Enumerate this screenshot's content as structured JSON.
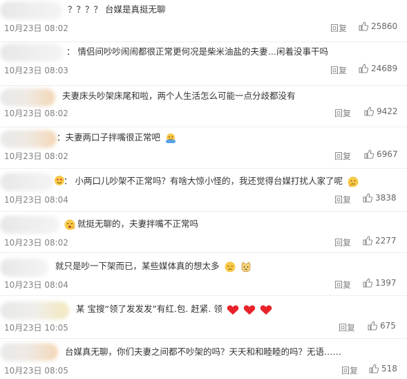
{
  "reply_label": "回复",
  "icons": {
    "like": "thumbs-up-icon",
    "heart": "heart-icon"
  },
  "comments": [
    {
      "text": "？？？？ 台媒是真挺无聊",
      "time": "10月23日 08:02",
      "likes": "25860"
    },
    {
      "text": "： 情侣间吵吵闹闹都很正常更何况是柴米油盐的夫妻…闲着没事干吗",
      "time": "10月23日 08:03",
      "likes": "24689"
    },
    {
      "text": "夫妻床头吵架床尾和啦，两个人生活怎么可能一点分歧都没有",
      "time": "10月23日 08:02",
      "likes": "9422"
    },
    {
      "text": "：夫妻两口子拌嘴很正常吧",
      "time": "10月23日 08:02",
      "likes": "6967",
      "emoji": "hug-emoji"
    },
    {
      "text": "： 小两口儿吵架不正常吗？有啥大惊小怪的，我还觉得台媒打扰人家了呢",
      "time": "10月23日 08:04",
      "likes": "3838",
      "emoji": "thinking-emoji"
    },
    {
      "text": "就挺无聊的，夫妻拌嘴不正常吗",
      "time": "10月23日 08:02",
      "likes": "2277",
      "emoji": "yawn-emoji"
    },
    {
      "text": "就只是吵一下架而已，某些媒体真的想太多",
      "time": "10月23日 08:04",
      "likes": "1397",
      "emoji": "smirk-emoji"
    },
    {
      "text": "某 宝搜“领了发发发”有红.包. 赶紧. 领",
      "time": "10月23日 10:05",
      "likes": "675",
      "emoji": "three-hearts"
    },
    {
      "text": "台媒真无聊，你们夫妻之间都不吵架的吗？天天和和睦睦的吗？无语……",
      "time": "10月23日 08:05",
      "likes": "518"
    }
  ]
}
